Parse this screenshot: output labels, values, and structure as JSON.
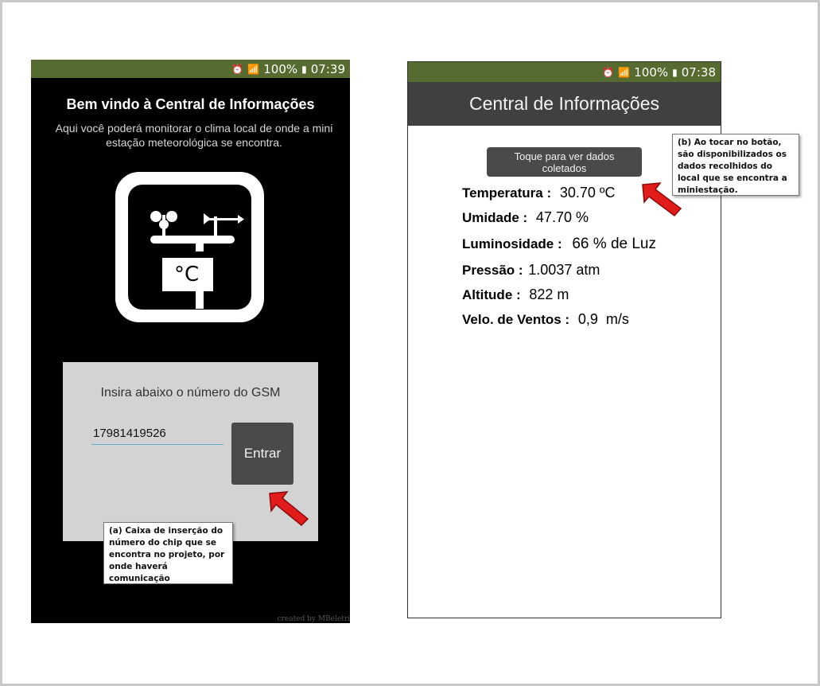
{
  "left_screen": {
    "status": {
      "alarm_icon": "alarm-clock-icon",
      "wifi_icon": "wifi-icon",
      "signal_icon": "signal-bars-icon",
      "battery": "100%",
      "time": "07:39"
    },
    "welcome_title": "Bem vindo à Central de Informações",
    "welcome_subtitle": "Aqui você poderá monitorar o clima local de onde a mini estação meteorológica se encontra.",
    "app_icon": "weather-station-icon",
    "icon_unit": "°C",
    "gsm_prompt": "Insira abaixo o número do GSM",
    "gsm_number": "17981419526",
    "enter_label": "Entrar",
    "credit": "created by MBeletri"
  },
  "right_screen": {
    "status": {
      "battery": "100%",
      "time": "07:38"
    },
    "app_title": "Central de Informações",
    "view_data_label": "Toque para ver dados coletados",
    "readings": [
      {
        "label": "Temperatura :",
        "value": "30.70 ºC"
      },
      {
        "label": "Umidade :",
        "value": "47.70 %"
      },
      {
        "label": "Luminosidade :",
        "value": "66 % de Luz"
      },
      {
        "label": "Pressão :",
        "value": "1.0037 atm"
      },
      {
        "label": "Altitude :",
        "value": "822 m"
      },
      {
        "label": "Velo. de Ventos :",
        "value": "0,9  m/s"
      }
    ]
  },
  "annotations": {
    "a": "(a) Caixa de inserção do número do chip que se encontra no projeto, por onde haverá comunicação",
    "b": "(b) Ao tocar no botão, são disponibilizados os dados recolhidos do local que se encontra a miniestação."
  },
  "colors": {
    "status_bar": "#556b2f",
    "app_bar": "#404040",
    "button": "#4a4a4a",
    "arrow": "#e21b1b"
  }
}
